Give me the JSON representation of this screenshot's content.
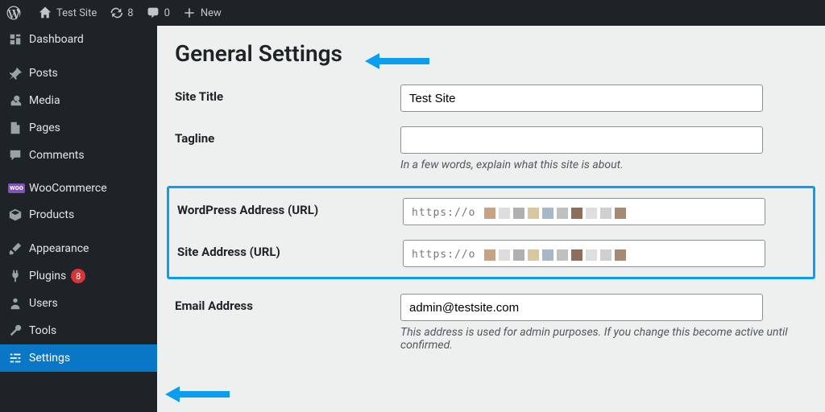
{
  "topbar": {
    "site_name": "Test Site",
    "updates_count": "8",
    "comments_count": "0",
    "new_label": "New"
  },
  "sidebar": {
    "items": [
      {
        "label": "Dashboard"
      },
      {
        "label": "Posts"
      },
      {
        "label": "Media"
      },
      {
        "label": "Pages"
      },
      {
        "label": "Comments"
      },
      {
        "label": "WooCommerce"
      },
      {
        "label": "Products"
      },
      {
        "label": "Appearance"
      },
      {
        "label": "Plugins",
        "badge": "8"
      },
      {
        "label": "Users"
      },
      {
        "label": "Tools"
      },
      {
        "label": "Settings"
      }
    ]
  },
  "page": {
    "title": "General Settings",
    "site_title_label": "Site Title",
    "site_title_value": "Test Site",
    "tagline_label": "Tagline",
    "tagline_value": "",
    "tagline_desc": "In a few words, explain what this site is about.",
    "wp_url_label": "WordPress Address (URL)",
    "wp_url_prefix": "https://o",
    "site_url_label": "Site Address (URL)",
    "site_url_prefix": "https://o",
    "email_label": "Email Address",
    "email_value": "admin@testsite.com",
    "email_desc": "This address is used for admin purposes. If you change this become active until confirmed."
  }
}
